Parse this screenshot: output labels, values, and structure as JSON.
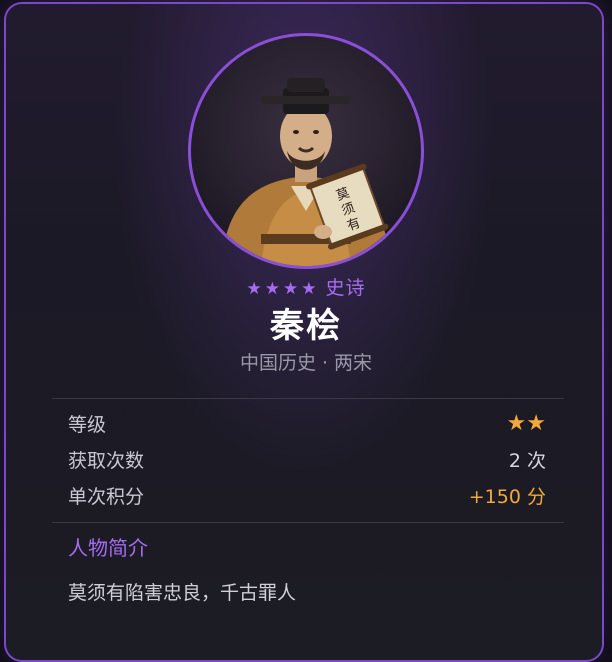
{
  "character": {
    "rarity_stars": "★★★★",
    "rarity_label": "史诗",
    "name": "秦桧",
    "origin": "中国历史 · 两宋",
    "portrait_scroll_text": "莫须有"
  },
  "stats": [
    {
      "label": "等级",
      "value": "★★"
    },
    {
      "label": "获取次数",
      "value": "2 次"
    },
    {
      "label": "单次积分",
      "value": "+150 分"
    }
  ],
  "bio": {
    "title": "人物简介",
    "text": "莫须有陷害忠良，千古罪人"
  },
  "colors": {
    "accent_purple": "#a66cf0",
    "border_purple": "#7a48c8",
    "gold": "#f2a83a"
  }
}
